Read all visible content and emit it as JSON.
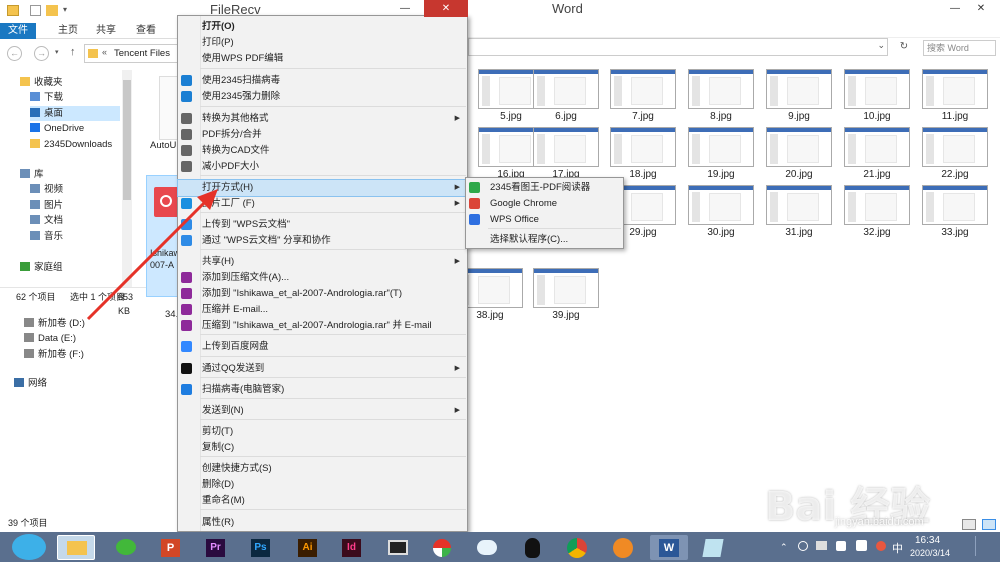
{
  "back_window": {
    "title": "Word",
    "search_placeholder": "搜索 Word",
    "thumbs": [
      "5.jpg",
      "6.jpg",
      "7.jpg",
      "8.jpg",
      "9.jpg",
      "10.jpg",
      "11.jpg",
      "16.jpg",
      "17.jpg",
      "18.jpg",
      "19.jpg",
      "20.jpg",
      "21.jpg",
      "22.jpg",
      "29.jpg",
      "30.jpg",
      "31.jpg",
      "32.jpg",
      "33.jpg",
      "38.jpg",
      "39.jpg"
    ]
  },
  "explorer": {
    "title": "FileRecv",
    "ribbon_tabs": [
      "文件",
      "主页",
      "共享",
      "查看"
    ],
    "breadcrumb": "Tencent Files",
    "tree": [
      "收藏夹",
      "下载",
      "桌面",
      "OneDrive",
      "2345Downloads",
      "库",
      "视频",
      "图片",
      "文档",
      "音乐",
      "家庭组",
      "新加卷 (D:)",
      "Data (E:)",
      "新加卷 (F:)",
      "网络"
    ],
    "file_left": "AutoU",
    "file_sel": "Ishikawa_",
    "file_sel2": "007-A",
    "file_34": "34.",
    "status_count": "62 个项目",
    "status_selected": "选中 1 个项目",
    "status_size": "653 KB",
    "status_bottom": "39 个项目"
  },
  "context_menu": {
    "items": [
      {
        "label": "打开(O)",
        "bold": true
      },
      {
        "label": "打印(P)"
      },
      {
        "label": "使用WPS PDF编辑"
      },
      {
        "label": "使用2345扫描病毒",
        "icon": "shield-icon"
      },
      {
        "label": "使用2345强力删除",
        "icon": "shield-icon"
      },
      {
        "label": "转换为其他格式",
        "icon": "convert-icon",
        "sub": true
      },
      {
        "label": "PDF拆分/合并",
        "icon": "pdf-icon"
      },
      {
        "label": "转换为CAD文件",
        "icon": "cad-icon"
      },
      {
        "label": "减小PDF大小",
        "icon": "compress-pdf-icon"
      },
      {
        "label": "打开方式(H)",
        "sub": true
      },
      {
        "label": "图片工厂 (F)",
        "icon": "picture-factory-icon",
        "sub": true
      },
      {
        "label": "上传到 \"WPS云文档\"",
        "icon": "cloud-icon"
      },
      {
        "label": "通过 \"WPS云文档\" 分享和协作",
        "icon": "share-icon"
      },
      {
        "label": "共享(H)",
        "sub": true
      },
      {
        "label": "添加到压缩文件(A)...",
        "icon": "rar-icon"
      },
      {
        "label": "添加到 \"Ishikawa_et_al-2007-Andrologia.rar\"(T)",
        "icon": "rar-icon"
      },
      {
        "label": "压缩并 E-mail...",
        "icon": "rar-icon"
      },
      {
        "label": "压缩到 \"Ishikawa_et_al-2007-Andrologia.rar\" 并 E-mail",
        "icon": "rar-icon"
      },
      {
        "label": "上传到百度网盘",
        "icon": "baidu-netdisk-icon"
      },
      {
        "label": "通过QQ发送到",
        "icon": "qq-icon",
        "sub": true
      },
      {
        "label": "扫描病毒(电脑管家)",
        "icon": "tencent-guard-icon"
      },
      {
        "label": "发送到(N)",
        "sub": true
      },
      {
        "label": "剪切(T)"
      },
      {
        "label": "复制(C)"
      },
      {
        "label": "创建快捷方式(S)"
      },
      {
        "label": "删除(D)"
      },
      {
        "label": "重命名(M)"
      },
      {
        "label": "属性(R)"
      }
    ],
    "submenu": [
      {
        "label": "2345看图王-PDF阅读器",
        "icon": "2345-viewer-icon"
      },
      {
        "label": "Google Chrome",
        "icon": "chrome-icon"
      },
      {
        "label": "WPS Office",
        "icon": "wps-icon"
      },
      {
        "label": "选择默认程序(C)..."
      }
    ]
  },
  "taskbar": {
    "apps": [
      "Ai",
      "Id",
      "Pr",
      "Ps",
      "P",
      "W"
    ],
    "time": "16:34",
    "date": "2020/3/14",
    "ime": "中"
  },
  "watermark": {
    "text": "Bai 经验",
    "url": "jingyan.baidu.com"
  }
}
